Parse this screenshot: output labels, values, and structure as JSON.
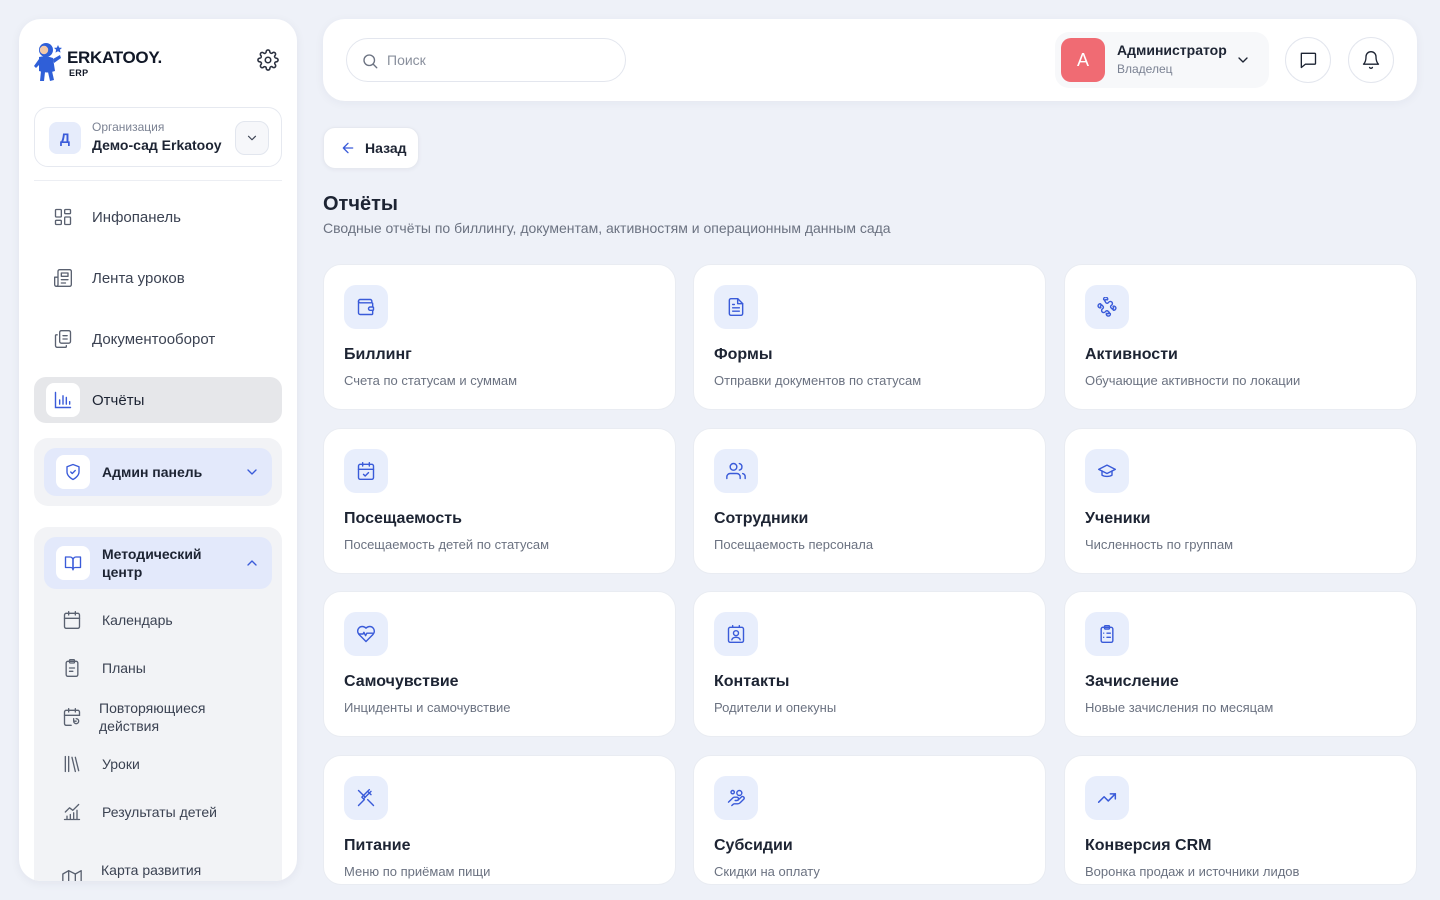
{
  "brand": {
    "name": "ERKATOOY.",
    "sub": "ERP"
  },
  "organization": {
    "caption": "Организация",
    "name": "Демо-сад Erkatooy",
    "initial": "Д"
  },
  "nav": [
    {
      "label": "Инфопанель",
      "icon": "dashboard-icon"
    },
    {
      "label": "Лента уроков",
      "icon": "newspaper-icon"
    },
    {
      "label": "Документооборот",
      "icon": "documents-icon"
    },
    {
      "label": "Отчёты",
      "icon": "bar-chart-icon",
      "active": true
    }
  ],
  "admin_group": {
    "label": "Админ панель",
    "icon": "shield-icon",
    "expanded": false
  },
  "method_group": {
    "label": "Методический центр",
    "icon": "book-icon",
    "expanded": true,
    "items": [
      {
        "label": "Календарь",
        "icon": "calendar-icon"
      },
      {
        "label": "Планы",
        "icon": "clipboard-icon"
      },
      {
        "label": "Повторяющиеся действия",
        "icon": "calendar-repeat-icon"
      },
      {
        "label": "Уроки",
        "icon": "library-icon"
      },
      {
        "label": "Результаты детей",
        "icon": "growth-chart-icon"
      },
      {
        "label": "Карта развития ребенка",
        "icon": "map-icon"
      }
    ]
  },
  "search": {
    "placeholder": "Поиск",
    "value": ""
  },
  "user": {
    "initial": "А",
    "name": "Администратор",
    "role": "Владелец"
  },
  "back": {
    "label": "Назад"
  },
  "page": {
    "title": "Отчёты",
    "subtitle": "Сводные отчёты по биллингу, документам, активностям и операционным данным сада"
  },
  "reports": [
    {
      "title": "Биллинг",
      "desc": "Счета по статусам и суммам",
      "icon": "wallet-icon"
    },
    {
      "title": "Формы",
      "desc": "Отправки документов по статусам",
      "icon": "file-text-icon"
    },
    {
      "title": "Активности",
      "desc": "Обучающие активности по локации",
      "icon": "puzzle-icon"
    },
    {
      "title": "Посещаемость",
      "desc": "Посещаемость детей по статусам",
      "icon": "calendar-check-icon"
    },
    {
      "title": "Сотрудники",
      "desc": "Посещаемость персонала",
      "icon": "users-icon"
    },
    {
      "title": "Ученики",
      "desc": "Численность по группам",
      "icon": "graduation-cap-icon"
    },
    {
      "title": "Самочувствие",
      "desc": "Инциденты и самочувствие",
      "icon": "heart-pulse-icon"
    },
    {
      "title": "Контакты",
      "desc": "Родители и опекуны",
      "icon": "contact-icon"
    },
    {
      "title": "Зачисление",
      "desc": "Новые зачисления по месяцам",
      "icon": "clipboard-list-icon"
    },
    {
      "title": "Питание",
      "desc": "Меню по приёмам пищи",
      "icon": "utensils-icon"
    },
    {
      "title": "Субсидии",
      "desc": "Скидки на оплату",
      "icon": "hand-coins-icon"
    },
    {
      "title": "Конверсия CRM",
      "desc": "Воронка продаж и источники лидов",
      "icon": "trending-up-icon"
    }
  ],
  "colors": {
    "accent": "#3a5bd9",
    "icon_bg": "#e8eefc",
    "avatar": "#f06b73",
    "background": "#eef1f8"
  }
}
